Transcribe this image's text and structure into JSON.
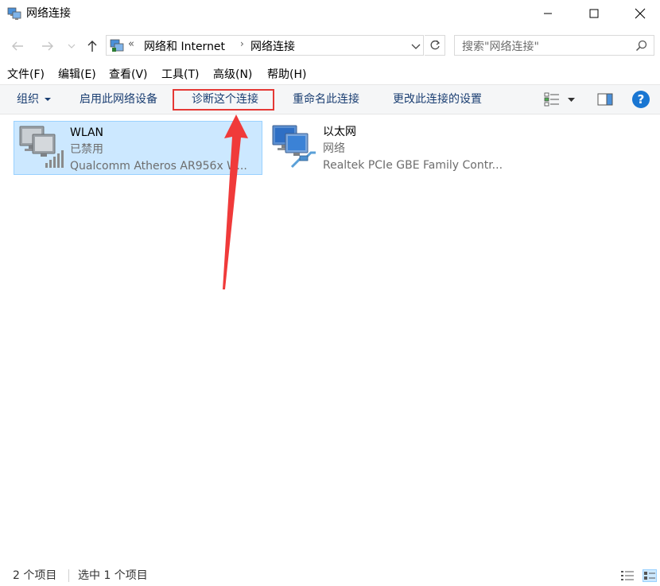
{
  "window": {
    "title": "网络连接"
  },
  "address": {
    "prefix_chevron": "«",
    "crumb1": "网络和 Internet",
    "separator": "›",
    "crumb2": "网络连接"
  },
  "search": {
    "placeholder": "搜索\"网络连接\""
  },
  "menu": {
    "items": [
      "文件(F)",
      "编辑(E)",
      "查看(V)",
      "工具(T)",
      "高级(N)",
      "帮助(H)"
    ]
  },
  "toolbar": {
    "organize": "组织",
    "enable": "启用此网络设备",
    "diagnose": "诊断这个连接",
    "rename": "重命名此连接",
    "settings": "更改此连接的设置",
    "help": "?"
  },
  "connections": [
    {
      "name": "WLAN",
      "status": "已禁用",
      "device": "Qualcomm Atheros AR956x W...",
      "selected": true,
      "icon": "wireless-network-icon"
    },
    {
      "name": "以太网",
      "status": "网络",
      "device": "Realtek PCIe GBE Family Contr...",
      "selected": false,
      "icon": "ethernet-network-icon"
    }
  ],
  "statusbar": {
    "count": "2 个项目",
    "selected": "选中 1 个项目"
  },
  "colors": {
    "selection_bg": "#cce8ff",
    "selection_border": "#99d1ff",
    "highlight": "#e53935",
    "link_text": "#1a3e72",
    "help_bg": "#1976d2"
  }
}
